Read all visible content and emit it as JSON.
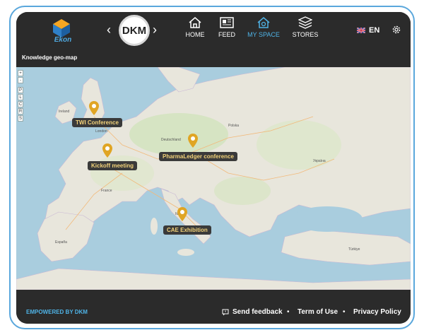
{
  "header": {
    "logo_text": "Ekon",
    "dkm_badge": "DKM",
    "nav": [
      {
        "label": "HOME",
        "icon": "home-icon"
      },
      {
        "label": "FEED",
        "icon": "newspaper-icon"
      },
      {
        "label": "MY SPACE",
        "icon": "myspace-icon",
        "active": true
      },
      {
        "label": "STORES",
        "icon": "layers-icon"
      }
    ],
    "language": "EN"
  },
  "subheader": {
    "title": "Knowledge geo-map"
  },
  "map": {
    "events": [
      {
        "label": "TWI Conference"
      },
      {
        "label": "Kickoff meeting"
      },
      {
        "label": "PharmaLedger conference"
      },
      {
        "label": "CAE Exhibition"
      }
    ],
    "zoom_controls": [
      "+",
      "-",
      "P",
      "L",
      "C",
      "R",
      "S"
    ],
    "place_names": [
      "Ireland",
      "London",
      "France",
      "Italia",
      "Deutschland",
      "Polska",
      "Україна",
      "España",
      "Türkiye"
    ]
  },
  "footer": {
    "powered": "EMPOWERED BY DKM",
    "feedback": "Send feedback",
    "terms": "Term of Use",
    "privacy": "Privacy Policy"
  },
  "colors": {
    "accent": "#4fb3e6",
    "frame": "#5aa7dc",
    "pin": "#e0a524",
    "sea": "#a9cdde",
    "land": "#e8e6dc"
  }
}
